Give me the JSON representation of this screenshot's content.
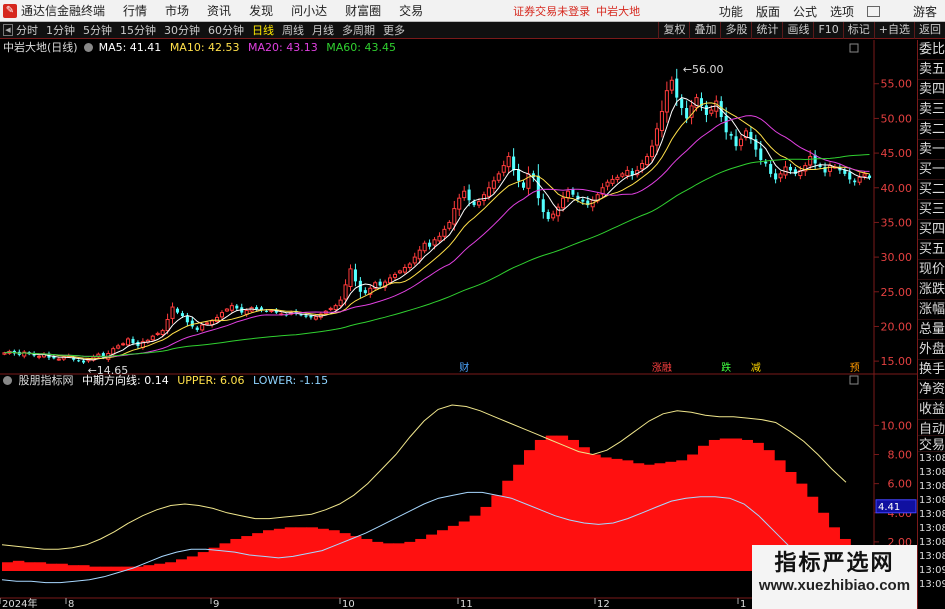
{
  "titlebar": {
    "app_name": "通达信金融终端",
    "menus": [
      "行情",
      "市场",
      "资讯",
      "发现",
      "问小达",
      "财富圈",
      "交易"
    ],
    "notice": "证券交易未登录",
    "notice_stock": "中岩大地",
    "right_menus": [
      "功能",
      "版面",
      "公式",
      "选项"
    ],
    "guest": "游客"
  },
  "toolbar": {
    "periods": [
      "分时",
      "1分钟",
      "5分钟",
      "15分钟",
      "30分钟",
      "60分钟",
      "日线",
      "周线",
      "月线",
      "多周期",
      "更多"
    ],
    "active_period": "日线",
    "right_tools": [
      "复权",
      "叠加",
      "多股",
      "统计",
      "画线",
      "F10",
      "标记",
      "+自选",
      "返回"
    ]
  },
  "main_chart": {
    "stock_name": "中岩大地(日线)",
    "ma": [
      {
        "label": "MA5: 41.41",
        "color": "#ffffff"
      },
      {
        "label": "MA10: 42.53",
        "color": "#ffe04a"
      },
      {
        "label": "MA20: 43.13",
        "color": "#e040e0"
      },
      {
        "label": "MA60: 43.45",
        "color": "#30d030"
      }
    ],
    "high_label": "56.00",
    "low_label": "14.65",
    "markers": [
      {
        "text": "财",
        "color": "#4da6ff",
        "day": 93
      },
      {
        "text": "涨融",
        "color": "#ff4040",
        "day": 133
      },
      {
        "text": "跌",
        "color": "#40ff40",
        "day": 146
      },
      {
        "text": "减",
        "color": "#ffd700",
        "day": 152
      },
      {
        "text": "预",
        "color": "#ff9900",
        "day": 172
      }
    ]
  },
  "chart_data": [
    {
      "type": "candlestick",
      "title": "中岩大地(日线)",
      "ylim": [
        13,
        59
      ],
      "y_ticks": [
        "15.00",
        "20.00",
        "25.00",
        "30.00",
        "35.00",
        "40.00",
        "45.00",
        "50.00",
        "55.00"
      ],
      "close_series_approx": [
        16.2,
        16.4,
        16.1,
        15.9,
        16.3,
        16.0,
        15.8,
        15.7,
        16.0,
        15.5,
        15.4,
        15.3,
        15.6,
        15.8,
        15.2,
        15.0,
        14.8,
        15.3,
        15.6,
        16.0,
        15.5,
        16.1,
        16.8,
        17.2,
        17.5,
        18.2,
        17.6,
        17.2,
        17.8,
        18.0,
        18.6,
        19.0,
        19.4,
        21.0,
        22.8,
        22.0,
        21.5,
        20.6,
        20.0,
        19.5,
        20.2,
        20.5,
        20.8,
        21.3,
        22.0,
        22.5,
        23.0,
        22.6,
        22.0,
        22.3,
        22.7,
        22.5,
        22.4,
        22.2,
        22.3,
        22.0,
        21.8,
        21.7,
        22.0,
        21.9,
        21.6,
        21.4,
        21.3,
        21.4,
        21.8,
        22.2,
        22.6,
        23.0,
        23.8,
        26.0,
        28.3,
        26.5,
        25.0,
        24.8,
        25.5,
        26.3,
        25.9,
        26.4,
        27.0,
        27.5,
        28.0,
        28.5,
        29.0,
        30.0,
        31.0,
        32.0,
        31.5,
        32.5,
        33.0,
        34.0,
        35.0,
        37.0,
        38.5,
        39.5,
        38.2,
        37.5,
        38.0,
        39.0,
        40.0,
        41.0,
        42.0,
        43.2,
        44.5,
        42.5,
        41.0,
        40.0,
        42.0,
        41.5,
        38.5,
        36.5,
        35.5,
        36.2,
        37.2,
        38.5,
        39.5,
        39.0,
        38.3,
        38.0,
        37.5,
        38.2,
        39.0,
        40.0,
        40.8,
        41.2,
        41.5,
        42.0,
        42.5,
        41.8,
        42.5,
        43.5,
        44.5,
        46.0,
        48.5,
        51.0,
        54.0,
        55.5,
        53.0,
        51.5,
        50.0,
        51.8,
        53.0,
        51.8,
        50.5,
        51.2,
        52.5,
        50.2,
        48.0,
        47.5,
        46.0,
        47.0,
        48.2,
        47.0,
        45.5,
        44.0,
        43.5,
        42.0,
        41.2,
        42.0,
        43.0,
        42.5,
        42.0,
        42.5,
        43.2,
        44.5,
        43.5,
        43.0,
        42.2,
        43.2,
        43.0,
        42.5,
        42.0,
        41.2,
        40.8,
        41.5,
        42.0,
        41.41
      ],
      "series": [
        {
          "name": "MA5",
          "last": 41.41
        },
        {
          "name": "MA10",
          "last": 42.53
        },
        {
          "name": "MA20",
          "last": 43.13
        },
        {
          "name": "MA60",
          "last": 43.45
        }
      ],
      "annotations": [
        "56.00",
        "14.65"
      ]
    },
    {
      "type": "area",
      "title": "股朋指标网 中期方向线",
      "ylim": [
        0,
        12.5
      ],
      "y_ticks": [
        "2.00",
        "4.00",
        "6.00",
        "8.00",
        "10.00"
      ],
      "current_marker": "4.41",
      "series": [
        {
          "name": "中期方向线",
          "last": 0.14
        },
        {
          "name": "UPPER",
          "last": 6.06
        },
        {
          "name": "LOWER",
          "last": -1.15
        }
      ],
      "red_area_approx": [
        0.6,
        0.7,
        0.6,
        0.6,
        0.5,
        0.5,
        0.4,
        0.4,
        0.3,
        0.3,
        0.3,
        0.3,
        0.3,
        0.4,
        0.5,
        0.6,
        0.8,
        1.0,
        1.3,
        1.6,
        1.9,
        2.2,
        2.4,
        2.6,
        2.8,
        2.9,
        3.0,
        3.0,
        3.0,
        2.9,
        2.8,
        2.6,
        2.4,
        2.2,
        2.0,
        1.9,
        1.9,
        2.0,
        2.2,
        2.5,
        2.8,
        3.1,
        3.4,
        3.8,
        4.4,
        5.2,
        6.2,
        7.3,
        8.3,
        9.0,
        9.3,
        9.3,
        9.0,
        8.5,
        8.0,
        7.8,
        7.7,
        7.6,
        7.4,
        7.3,
        7.4,
        7.5,
        7.6,
        8.0,
        8.6,
        9.0,
        9.1,
        9.1,
        9.0,
        8.8,
        8.3,
        7.6,
        6.8,
        6.0,
        5.1,
        4.0,
        3.0,
        2.2,
        1.6,
        1.2
      ],
      "upper_line_approx": [
        1.8,
        1.7,
        1.6,
        1.5,
        1.5,
        1.6,
        1.8,
        2.2,
        2.7,
        3.3,
        3.8,
        4.2,
        4.5,
        4.6,
        4.5,
        4.3,
        4.0,
        3.8,
        3.6,
        3.6,
        3.7,
        3.8,
        3.9,
        4.2,
        4.6,
        5.2,
        6.0,
        7.0,
        8.0,
        9.2,
        10.3,
        11.1,
        11.4,
        11.3,
        11.0,
        10.6,
        10.2,
        9.8,
        9.4,
        9.0,
        8.6,
        8.2,
        8.0,
        8.3,
        8.9,
        9.6,
        10.3,
        10.8,
        11.0,
        10.9,
        10.7,
        10.6,
        10.6,
        10.5,
        10.4,
        10.2,
        9.6,
        8.9,
        8.0,
        7.0,
        6.1
      ],
      "lower_line_approx": [
        -0.6,
        -0.7,
        -0.7,
        -0.8,
        -0.8,
        -0.7,
        -0.6,
        -0.4,
        -0.1,
        0.2,
        0.6,
        1.0,
        1.3,
        1.5,
        1.5,
        1.4,
        1.3,
        1.1,
        1.0,
        0.9,
        1.0,
        1.2,
        1.4,
        1.8,
        2.2,
        2.6,
        3.1,
        3.6,
        4.1,
        4.6,
        5.0,
        5.2,
        5.4,
        5.4,
        5.2,
        5.0,
        4.6,
        4.2,
        3.8,
        3.5,
        3.3,
        3.2,
        3.3,
        3.6,
        4.0,
        4.4,
        4.8,
        5.0,
        5.1,
        5.1,
        5.0,
        4.6,
        3.8,
        2.8,
        1.8,
        0.8,
        -0.1,
        -0.8,
        -1.15
      ]
    }
  ],
  "indicator": {
    "name": "股朋指标网",
    "line_label": "中期方向线: 0.14",
    "upper_label": "UPPER: 6.06",
    "lower_label": "LOWER: -1.15"
  },
  "xaxis": {
    "labels": [
      "2024年",
      "8",
      "9",
      "10",
      "11",
      "12",
      "1"
    ]
  },
  "side_panel": {
    "items": [
      "委比",
      "卖五",
      "卖四",
      "卖三",
      "卖二",
      "卖一",
      "买一",
      "买二",
      "买三",
      "买四",
      "买五",
      "现价",
      "涨跌",
      "涨幅",
      "总量",
      "外盘",
      "换手",
      "净资",
      "收益",
      "自动",
      "交易"
    ],
    "times": [
      "13:08",
      "13:08",
      "13:08",
      "13:08",
      "13:08",
      "13:08",
      "13:08",
      "13:08",
      "13:09",
      "13:09"
    ]
  },
  "watermark": {
    "title": "指标严选网",
    "url": "www.xuezhibiao.com"
  },
  "colors": {
    "up": "#ff3c3c",
    "down": "#54ffff",
    "frame": "#7a1a1a",
    "ma5": "#ffffff",
    "ma10": "#ffe04a",
    "ma20": "#e040e0",
    "ma60": "#30d030"
  }
}
